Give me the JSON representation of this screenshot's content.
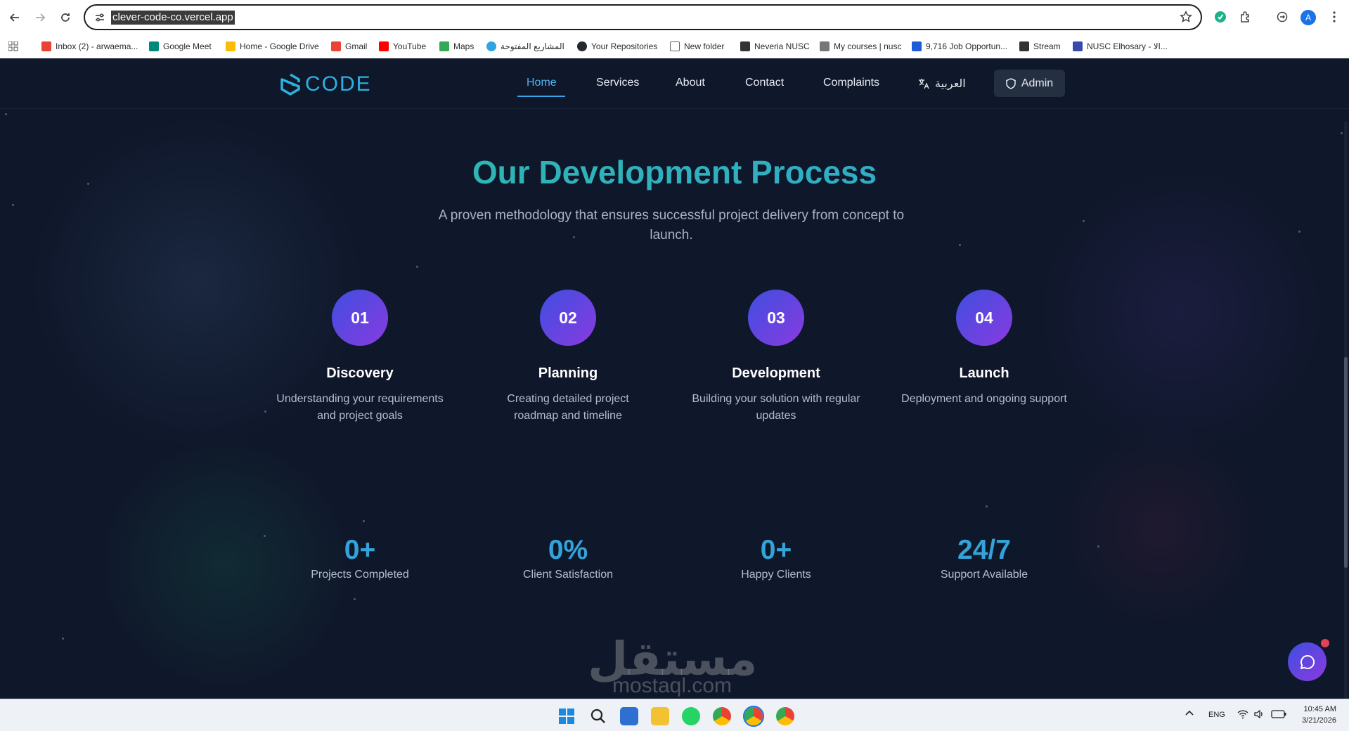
{
  "browser": {
    "url": "clever-code-co.vercel.app",
    "profile_initial": "A",
    "bookmarks": [
      {
        "label": "Inbox (2) - arwaema...",
        "icon": "gmail-icon",
        "color": "#ea4335"
      },
      {
        "label": "Google Meet",
        "icon": "meet-icon",
        "color": "#00897b"
      },
      {
        "label": "Home - Google Drive",
        "icon": "drive-icon",
        "color": "#fbbc04"
      },
      {
        "label": "Gmail",
        "icon": "gmail-icon",
        "color": "#ea4335"
      },
      {
        "label": "YouTube",
        "icon": "youtube-icon",
        "color": "#ff0000"
      },
      {
        "label": "Maps",
        "icon": "maps-icon",
        "color": "#34a853"
      },
      {
        "label": "المشاريع المفتوحة",
        "icon": "mostaql-icon",
        "color": "#2ca5e0"
      },
      {
        "label": "Your Repositories",
        "icon": "github-icon",
        "color": "#24292f"
      },
      {
        "label": "New folder",
        "icon": "folder-icon",
        "color": "#5f6368"
      },
      {
        "label": "Neveria NUSC",
        "icon": "portal-icon",
        "color": "#333333"
      },
      {
        "label": "My courses | nusc",
        "icon": "courses-icon",
        "color": "#555555"
      },
      {
        "label": "9,716 Job Opportun...",
        "icon": "wuzzuf-icon",
        "color": "#1e5bd8"
      },
      {
        "label": "Stream",
        "icon": "stream-icon",
        "color": "#333333"
      },
      {
        "label": "NUSC Elhosary - الا...",
        "icon": "nusc-icon",
        "color": "#3949ab"
      }
    ]
  },
  "site": {
    "logo_text": "CODE",
    "nav": {
      "home": "Home",
      "services": "Services",
      "about": "About",
      "contact": "Contact",
      "complaints": "Complaints",
      "language": "العربية",
      "admin": "Admin"
    },
    "process": {
      "title": "Our Development Process",
      "subtitle": "A proven methodology that ensures successful project delivery from concept to launch.",
      "steps": [
        {
          "number": "01",
          "title": "Discovery",
          "desc": "Understanding your requirements and project goals"
        },
        {
          "number": "02",
          "title": "Planning",
          "desc": "Creating detailed project roadmap and timeline"
        },
        {
          "number": "03",
          "title": "Development",
          "desc": "Building your solution with regular updates"
        },
        {
          "number": "04",
          "title": "Launch",
          "desc": "Deployment and ongoing support"
        }
      ]
    },
    "stats": [
      {
        "value": "0+",
        "label": "Projects Completed"
      },
      {
        "value": "0%",
        "label": "Client Satisfaction"
      },
      {
        "value": "0+",
        "label": "Happy Clients"
      },
      {
        "value": "24/7",
        "label": "Support Available"
      }
    ],
    "watermark": {
      "arabic": "مستقل",
      "latin": "mostaql.com"
    }
  },
  "taskbar": {
    "language": "ENG",
    "time": "10:45 AM",
    "date": "3/21/2026"
  },
  "colors": {
    "accent_blue": "#34a3d9",
    "accent_teal": "#2bbf9f",
    "accent_purple": "#8a3ae0",
    "page_bg": "#0f172a"
  }
}
